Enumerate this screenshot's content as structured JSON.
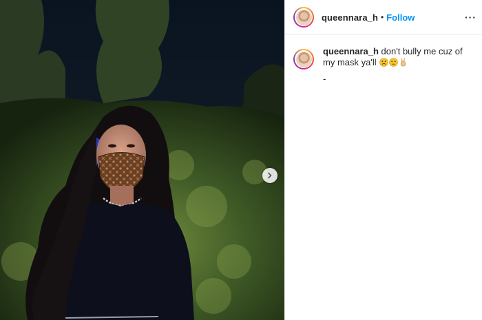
{
  "post": {
    "username": "queennara_h",
    "separator": "•",
    "follow_label": "Follow",
    "more_label": "···",
    "caption_username": "queennara_h",
    "caption_text": "don't bully me cuz of my mask ya'll",
    "caption_emojis": [
      "frowning-face",
      "unamused-face",
      "victory-hand"
    ],
    "caption_extra": "-"
  },
  "colors": {
    "follow_blue": "#0095f6",
    "text_dark": "#262626",
    "divider": "#efefef"
  },
  "icons": {
    "next_photo": "chevron-right-icon",
    "more_options": "more-dots-icon"
  }
}
